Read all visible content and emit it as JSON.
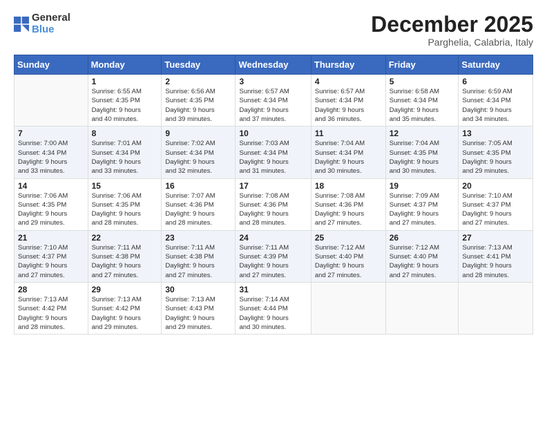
{
  "header": {
    "logo_general": "General",
    "logo_blue": "Blue",
    "month_title": "December 2025",
    "subtitle": "Parghelia, Calabria, Italy"
  },
  "weekdays": [
    "Sunday",
    "Monday",
    "Tuesday",
    "Wednesday",
    "Thursday",
    "Friday",
    "Saturday"
  ],
  "weeks": [
    [
      {
        "day": "",
        "info": ""
      },
      {
        "day": "1",
        "info": "Sunrise: 6:55 AM\nSunset: 4:35 PM\nDaylight: 9 hours\nand 40 minutes."
      },
      {
        "day": "2",
        "info": "Sunrise: 6:56 AM\nSunset: 4:35 PM\nDaylight: 9 hours\nand 39 minutes."
      },
      {
        "day": "3",
        "info": "Sunrise: 6:57 AM\nSunset: 4:34 PM\nDaylight: 9 hours\nand 37 minutes."
      },
      {
        "day": "4",
        "info": "Sunrise: 6:57 AM\nSunset: 4:34 PM\nDaylight: 9 hours\nand 36 minutes."
      },
      {
        "day": "5",
        "info": "Sunrise: 6:58 AM\nSunset: 4:34 PM\nDaylight: 9 hours\nand 35 minutes."
      },
      {
        "day": "6",
        "info": "Sunrise: 6:59 AM\nSunset: 4:34 PM\nDaylight: 9 hours\nand 34 minutes."
      }
    ],
    [
      {
        "day": "7",
        "info": "Sunrise: 7:00 AM\nSunset: 4:34 PM\nDaylight: 9 hours\nand 33 minutes."
      },
      {
        "day": "8",
        "info": "Sunrise: 7:01 AM\nSunset: 4:34 PM\nDaylight: 9 hours\nand 33 minutes."
      },
      {
        "day": "9",
        "info": "Sunrise: 7:02 AM\nSunset: 4:34 PM\nDaylight: 9 hours\nand 32 minutes."
      },
      {
        "day": "10",
        "info": "Sunrise: 7:03 AM\nSunset: 4:34 PM\nDaylight: 9 hours\nand 31 minutes."
      },
      {
        "day": "11",
        "info": "Sunrise: 7:04 AM\nSunset: 4:34 PM\nDaylight: 9 hours\nand 30 minutes."
      },
      {
        "day": "12",
        "info": "Sunrise: 7:04 AM\nSunset: 4:35 PM\nDaylight: 9 hours\nand 30 minutes."
      },
      {
        "day": "13",
        "info": "Sunrise: 7:05 AM\nSunset: 4:35 PM\nDaylight: 9 hours\nand 29 minutes."
      }
    ],
    [
      {
        "day": "14",
        "info": "Sunrise: 7:06 AM\nSunset: 4:35 PM\nDaylight: 9 hours\nand 29 minutes."
      },
      {
        "day": "15",
        "info": "Sunrise: 7:06 AM\nSunset: 4:35 PM\nDaylight: 9 hours\nand 28 minutes."
      },
      {
        "day": "16",
        "info": "Sunrise: 7:07 AM\nSunset: 4:36 PM\nDaylight: 9 hours\nand 28 minutes."
      },
      {
        "day": "17",
        "info": "Sunrise: 7:08 AM\nSunset: 4:36 PM\nDaylight: 9 hours\nand 28 minutes."
      },
      {
        "day": "18",
        "info": "Sunrise: 7:08 AM\nSunset: 4:36 PM\nDaylight: 9 hours\nand 27 minutes."
      },
      {
        "day": "19",
        "info": "Sunrise: 7:09 AM\nSunset: 4:37 PM\nDaylight: 9 hours\nand 27 minutes."
      },
      {
        "day": "20",
        "info": "Sunrise: 7:10 AM\nSunset: 4:37 PM\nDaylight: 9 hours\nand 27 minutes."
      }
    ],
    [
      {
        "day": "21",
        "info": "Sunrise: 7:10 AM\nSunset: 4:37 PM\nDaylight: 9 hours\nand 27 minutes."
      },
      {
        "day": "22",
        "info": "Sunrise: 7:11 AM\nSunset: 4:38 PM\nDaylight: 9 hours\nand 27 minutes."
      },
      {
        "day": "23",
        "info": "Sunrise: 7:11 AM\nSunset: 4:38 PM\nDaylight: 9 hours\nand 27 minutes."
      },
      {
        "day": "24",
        "info": "Sunrise: 7:11 AM\nSunset: 4:39 PM\nDaylight: 9 hours\nand 27 minutes."
      },
      {
        "day": "25",
        "info": "Sunrise: 7:12 AM\nSunset: 4:40 PM\nDaylight: 9 hours\nand 27 minutes."
      },
      {
        "day": "26",
        "info": "Sunrise: 7:12 AM\nSunset: 4:40 PM\nDaylight: 9 hours\nand 27 minutes."
      },
      {
        "day": "27",
        "info": "Sunrise: 7:13 AM\nSunset: 4:41 PM\nDaylight: 9 hours\nand 28 minutes."
      }
    ],
    [
      {
        "day": "28",
        "info": "Sunrise: 7:13 AM\nSunset: 4:42 PM\nDaylight: 9 hours\nand 28 minutes."
      },
      {
        "day": "29",
        "info": "Sunrise: 7:13 AM\nSunset: 4:42 PM\nDaylight: 9 hours\nand 29 minutes."
      },
      {
        "day": "30",
        "info": "Sunrise: 7:13 AM\nSunset: 4:43 PM\nDaylight: 9 hours\nand 29 minutes."
      },
      {
        "day": "31",
        "info": "Sunrise: 7:14 AM\nSunset: 4:44 PM\nDaylight: 9 hours\nand 30 minutes."
      },
      {
        "day": "",
        "info": ""
      },
      {
        "day": "",
        "info": ""
      },
      {
        "day": "",
        "info": ""
      }
    ]
  ]
}
